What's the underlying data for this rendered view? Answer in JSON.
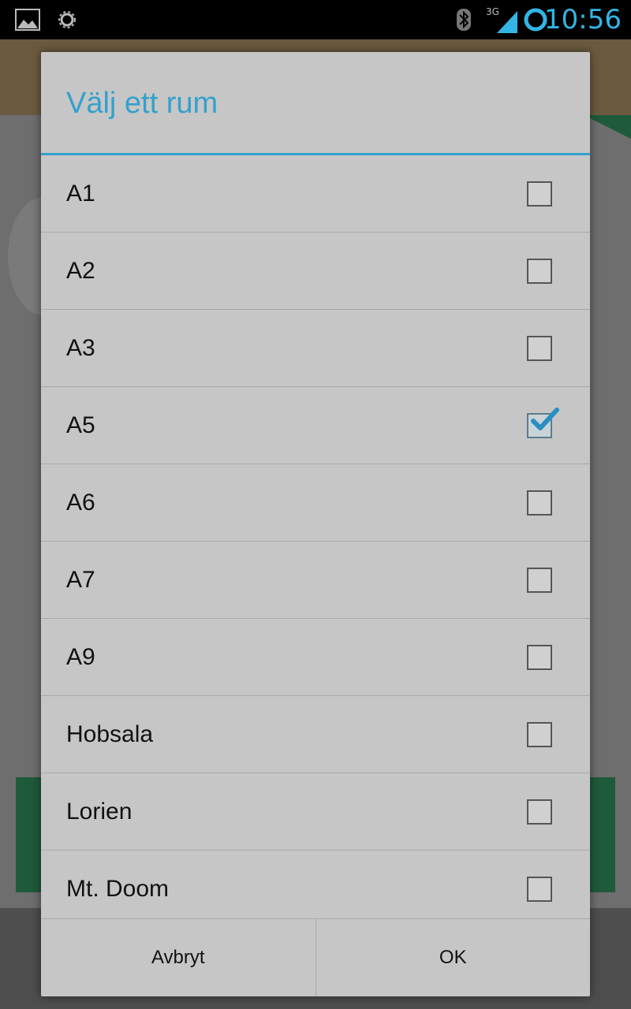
{
  "status_bar": {
    "time": "10:56",
    "network": "3G",
    "icons": [
      "image-notification-icon",
      "sync-icon",
      "bluetooth-icon",
      "signal-icon",
      "circle-status-icon"
    ]
  },
  "dialog": {
    "title": "Välj ett rum",
    "accent_color": "#33a1cc",
    "items": [
      {
        "label": "A1",
        "checked": false
      },
      {
        "label": "A2",
        "checked": false
      },
      {
        "label": "A3",
        "checked": false
      },
      {
        "label": "A5",
        "checked": true
      },
      {
        "label": "A6",
        "checked": false
      },
      {
        "label": "A7",
        "checked": false
      },
      {
        "label": "A9",
        "checked": false
      },
      {
        "label": "Hobsala",
        "checked": false
      },
      {
        "label": "Lorien",
        "checked": false
      },
      {
        "label": "Mt. Doom",
        "checked": false
      }
    ],
    "cancel_label": "Avbryt",
    "ok_label": "OK"
  }
}
